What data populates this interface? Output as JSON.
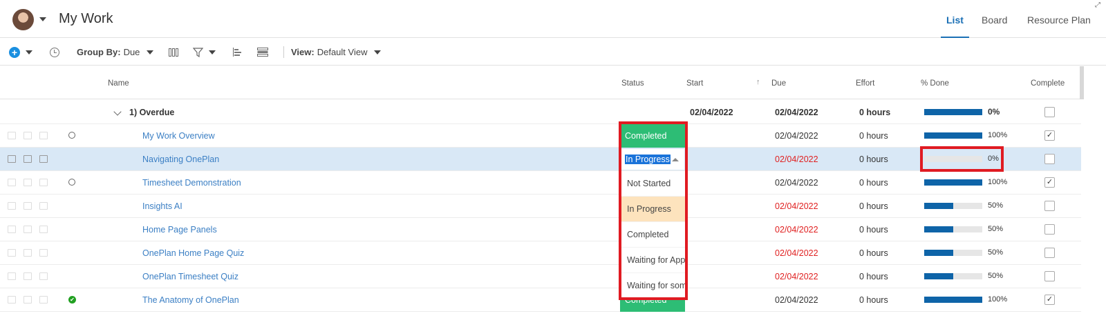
{
  "header": {
    "title": "My Work",
    "tabs": [
      "List",
      "Board",
      "Resource Plan"
    ]
  },
  "toolbar": {
    "group_by_label": "Group By:",
    "group_by_value": "Due",
    "view_label": "View:",
    "view_value": "Default View"
  },
  "columns": {
    "name": "Name",
    "status": "Status",
    "start": "Start",
    "due": "Due",
    "effort": "Effort",
    "percent_done": "% Done",
    "complete": "Complete"
  },
  "group": {
    "label": "1) Overdue",
    "start": "02/04/2022",
    "due": "02/04/2022",
    "effort": "0 hours",
    "percent": "0%",
    "progress": 0
  },
  "rows": [
    {
      "name": "My Work Overview",
      "status": "Completed",
      "due": "02/04/2022",
      "due_overdue": false,
      "effort": "0 hours",
      "percent": "100%",
      "progress": 1.0,
      "complete": true,
      "marker": "circle"
    },
    {
      "name": "Navigating OnePlan",
      "status": "In Progress",
      "due": "02/04/2022",
      "due_overdue": true,
      "effort": "0 hours",
      "percent": "0%",
      "progress": 0,
      "complete": false,
      "marker": "none"
    },
    {
      "name": "Timesheet Demonstration",
      "status": "",
      "due": "02/04/2022",
      "due_overdue": false,
      "effort": "0 hours",
      "percent": "100%",
      "progress": 1.0,
      "complete": true,
      "marker": "circle"
    },
    {
      "name": "Insights AI",
      "status": "",
      "due": "02/04/2022",
      "due_overdue": true,
      "effort": "0 hours",
      "percent": "50%",
      "progress": 0.5,
      "complete": false,
      "marker": "none"
    },
    {
      "name": "Home Page Panels",
      "status": "",
      "due": "02/04/2022",
      "due_overdue": true,
      "effort": "0 hours",
      "percent": "50%",
      "progress": 0.5,
      "complete": false,
      "marker": "none"
    },
    {
      "name": "OnePlan Home Page Quiz",
      "status": "",
      "due": "02/04/2022",
      "due_overdue": true,
      "effort": "0 hours",
      "percent": "50%",
      "progress": 0.5,
      "complete": false,
      "marker": "none"
    },
    {
      "name": "OnePlan Timesheet Quiz",
      "status": "",
      "due": "02/04/2022",
      "due_overdue": true,
      "effort": "0 hours",
      "percent": "50%",
      "progress": 0.5,
      "complete": false,
      "marker": "none"
    },
    {
      "name": "The Anatomy of OnePlan",
      "status": "Completed",
      "due": "02/04/2022",
      "due_overdue": false,
      "effort": "0 hours",
      "percent": "100%",
      "progress": 1.0,
      "complete": true,
      "marker": "check"
    }
  ],
  "status_dropdown": {
    "editing_value": "In Progress",
    "options": [
      "Not Started",
      "In Progress",
      "Completed",
      "Waiting for App",
      "Waiting for som"
    ],
    "hovered": "In Progress"
  },
  "colors": {
    "accent": "#1a6fb5",
    "completed": "#2dbd75",
    "progress_bar": "#0e64a8",
    "overdue": "#e02020",
    "highlight": "#e01b22"
  }
}
